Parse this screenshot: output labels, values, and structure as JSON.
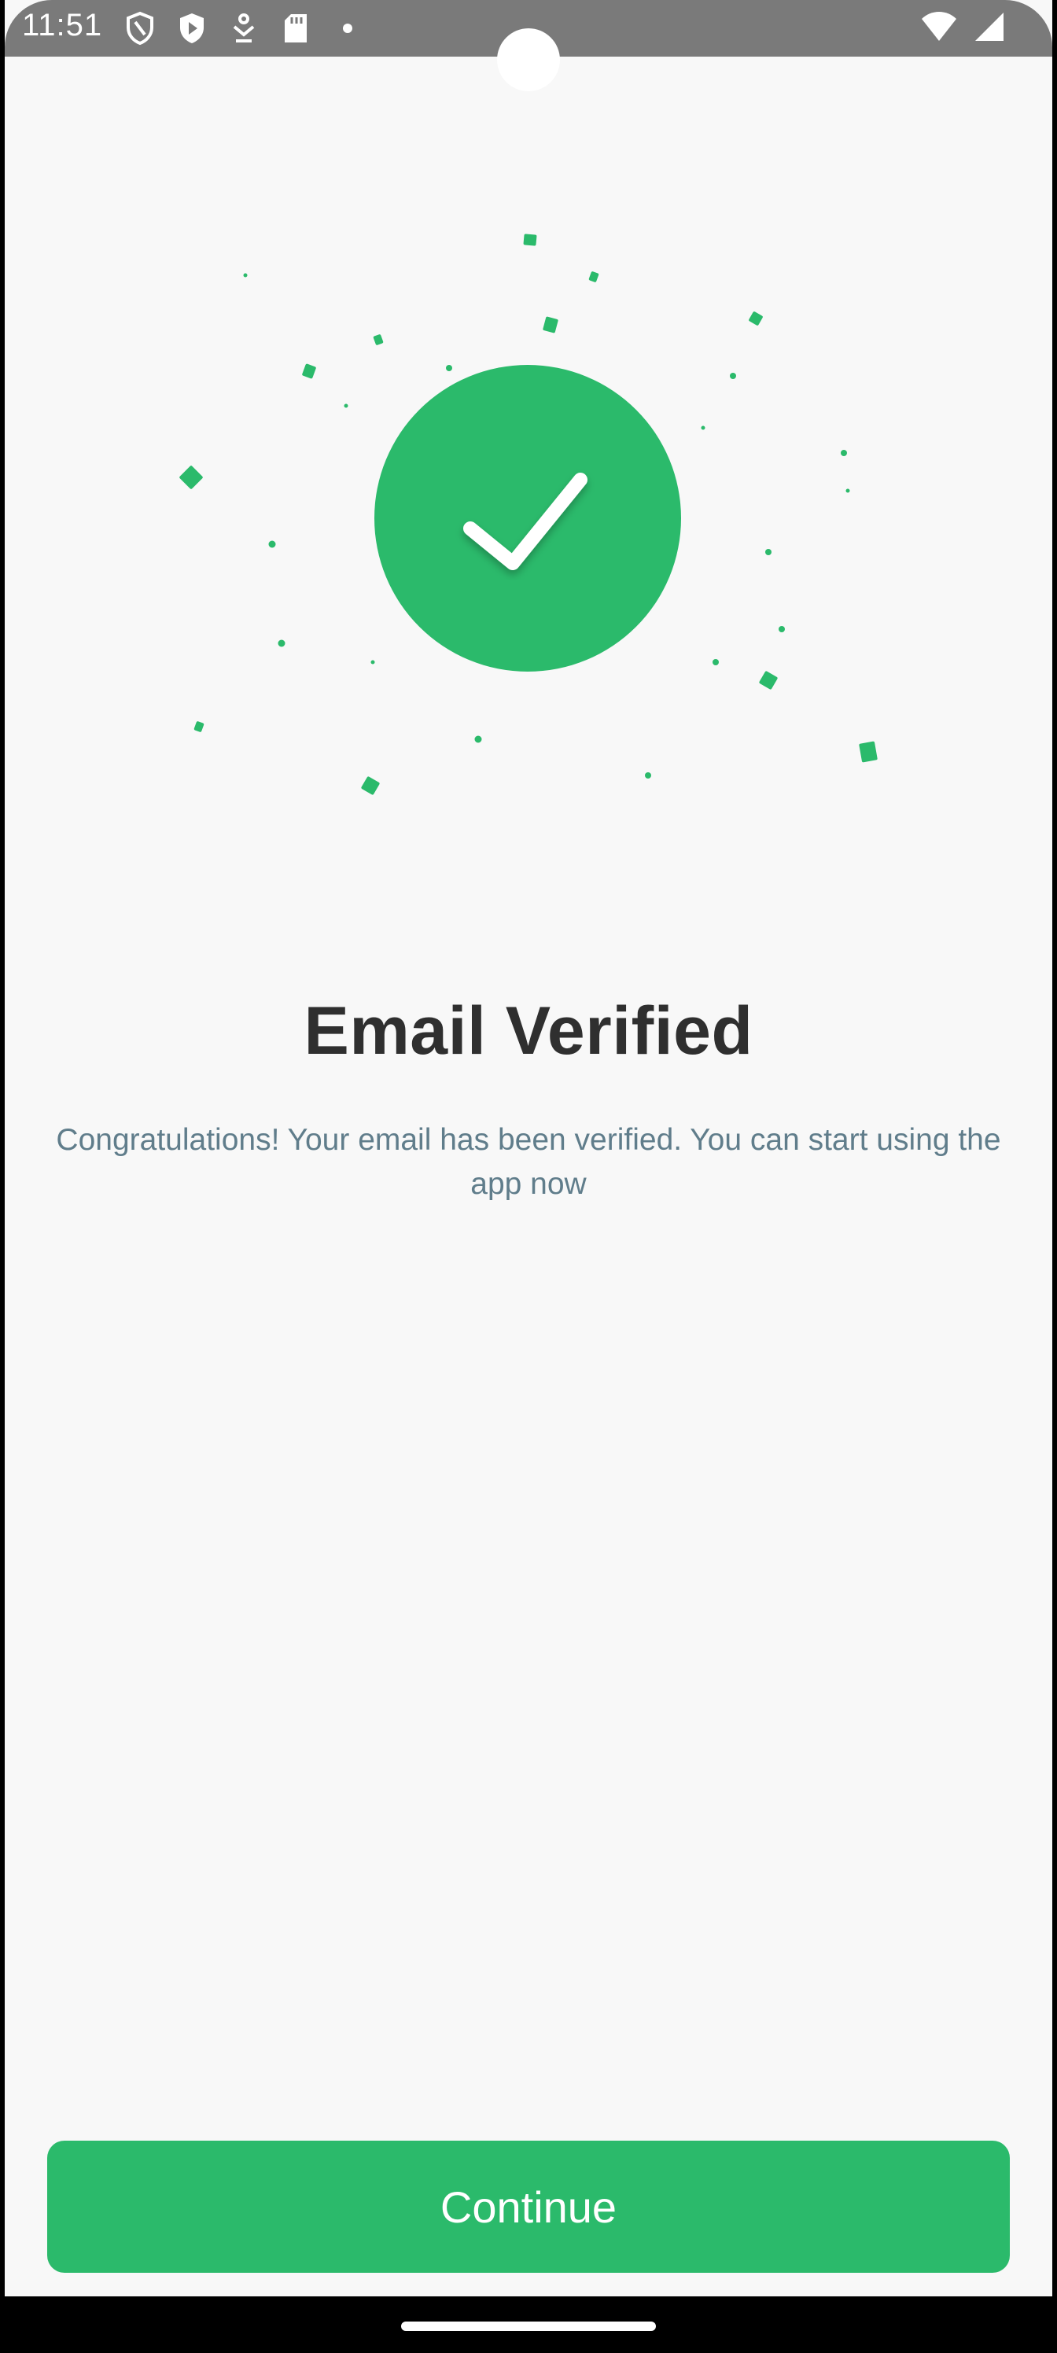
{
  "status_bar": {
    "time": "11:51",
    "left_icons": [
      "shield-outline-icon",
      "shield-play-icon",
      "download-icon",
      "sd-card-icon",
      "dot-icon"
    ],
    "right_icons": [
      "wifi-icon",
      "cellular-signal-icon"
    ]
  },
  "main": {
    "title": "Email Verified",
    "subtitle": "Congratulations! Your email has been verified. You can start using the app now",
    "continue_label": "Continue"
  },
  "colors": {
    "accent": "#2bba6b",
    "title": "#2f2f2f",
    "subtitle": "#607d8b",
    "background": "#f8f8f8",
    "status_bar": "#7a7a7a"
  }
}
